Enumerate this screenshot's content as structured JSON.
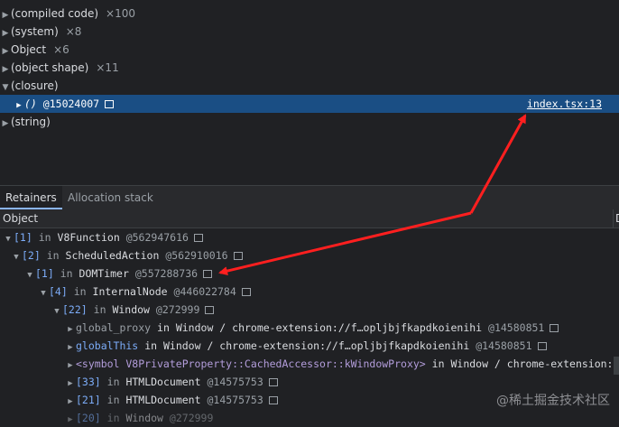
{
  "top_list": [
    {
      "label": "(compiled code)",
      "count": "×100"
    },
    {
      "label": "(system)",
      "count": "×8"
    },
    {
      "label": "Object",
      "count": "×6"
    },
    {
      "label": "(object shape)",
      "count": "×11"
    },
    {
      "label": "(closure)",
      "count": ""
    }
  ],
  "selected_row": {
    "name": "()",
    "id": "@15024007",
    "link": "index.tsx:13"
  },
  "string_row": {
    "label": "(string)"
  },
  "tabs": [
    "Retainers",
    "Allocation stack"
  ],
  "columns": {
    "object": "Object",
    "second": "D"
  },
  "retainers": [
    {
      "idx": "[1]",
      "in": "in",
      "type": "V8Function",
      "id": "@562947616"
    },
    {
      "idx": "[2]",
      "in": "in",
      "type": "ScheduledAction",
      "id": "@562910016"
    },
    {
      "idx": "[1]",
      "in": "in",
      "type": "DOMTimer",
      "id": "@557288736"
    },
    {
      "idx": "[4]",
      "in": "in",
      "type": "InternalNode",
      "id": "@446022784"
    },
    {
      "idx": "[22]",
      "in": "in",
      "type": "Window",
      "id": "@272999"
    },
    {
      "prop": "global_proxy",
      "in": "in",
      "type": "Window / chrome-extension://f…opljbjfkapdkoienihi",
      "id": "@14580851"
    },
    {
      "prop": "globalThis",
      "in": "in",
      "type": "Window / chrome-extension://f…opljbjfkapdkoienihi",
      "id": "@14580851"
    },
    {
      "prop": "<symbol V8PrivateProperty::CachedAccessor::kWindowProxy>",
      "in": "in",
      "type": "Window / chrome-extension://f…",
      "id": ""
    },
    {
      "idx": "[33]",
      "in": "in",
      "type": "HTMLDocument",
      "id": "@14575753"
    },
    {
      "idx": "[21]",
      "in": "in",
      "type": "HTMLDocument",
      "id": "@14575753"
    },
    {
      "idx": "[20]",
      "in": "in",
      "type": "Window",
      "id": "@272999"
    }
  ],
  "watermark": "@稀土掘金技术社区",
  "colors": {
    "background": "#202124",
    "selection": "#1a4e84",
    "arrow": "#ff1f1f",
    "index": "#7cacf8"
  }
}
